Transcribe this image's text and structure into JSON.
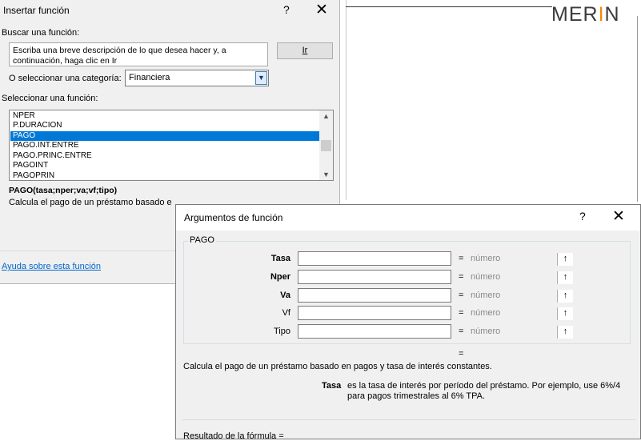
{
  "background": {
    "logo_text_main": "MER",
    "logo_text_accent": "I",
    "logo_text_end": "N",
    "logo_accent_color": "#f08c00"
  },
  "insert_function": {
    "title": "Insertar función",
    "help_symbol": "?",
    "close_symbol": "✕",
    "search_label": "Buscar una función:",
    "search_value": "Escriba una breve descripción de lo que desea hacer y, a continuación, haga clic en Ir",
    "go_button": "Ir",
    "category_label": "O seleccionar una categoría:",
    "category_value": "Financiera",
    "function_label": "Seleccionar una función:",
    "functions": [
      "NPER",
      "P.DURACION",
      "PAGO",
      "PAGO.INT.ENTRE",
      "PAGO.PRINC.ENTRE",
      "PAGOINT",
      "PAGOPRIN"
    ],
    "selected_function": "PAGO",
    "syntax": "PAGO(tasa;nper;va;vf;tipo)",
    "description": "Calcula el pago de un préstamo basado e",
    "help_link": "Ayuda sobre esta función"
  },
  "function_arguments": {
    "title": "Argumentos de función",
    "help_symbol": "?",
    "close_symbol": "✕",
    "group_title": "PAGO",
    "arguments": [
      {
        "label": "Tasa",
        "value": "",
        "type": "número",
        "bold": true
      },
      {
        "label": "Nper",
        "value": "",
        "type": "número",
        "bold": true
      },
      {
        "label": "Va",
        "value": "",
        "type": "número",
        "bold": true
      },
      {
        "label": "Vf",
        "value": "",
        "type": "número",
        "bold": false
      },
      {
        "label": "Tipo",
        "value": "",
        "type": "número",
        "bold": false
      }
    ],
    "equals": "=",
    "result_equals": "=",
    "description": "Calcula el pago de un préstamo basado en pagos y tasa de interés constantes.",
    "param_name": "Tasa",
    "param_description": "es la tasa de interés por período del préstamo. Por ejemplo, use 6%/4 para pagos trimestrales al 6% TPA.",
    "formula_result_label": "Resultado de la fórmula ="
  }
}
